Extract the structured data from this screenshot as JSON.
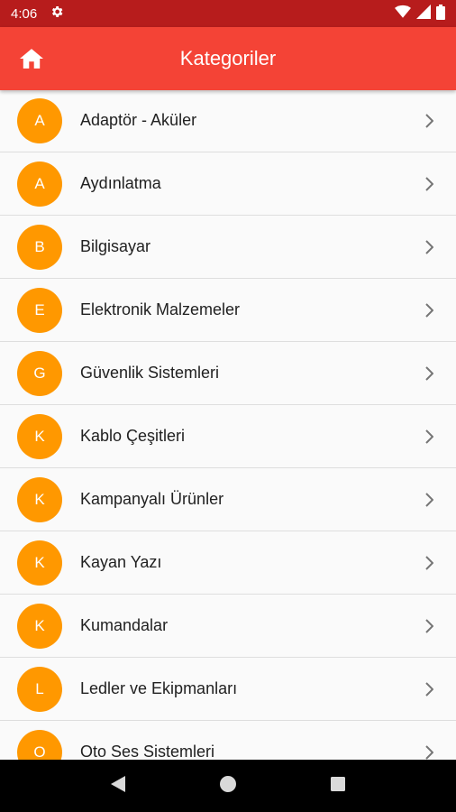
{
  "status_bar": {
    "time": "4:06"
  },
  "app_bar": {
    "title": "Kategoriler"
  },
  "colors": {
    "status_bar": "#b71c1c",
    "app_bar": "#f44336",
    "avatar": "#ff9800"
  },
  "categories": [
    {
      "letter": "A",
      "label": "Adaptör - Aküler"
    },
    {
      "letter": "A",
      "label": "Aydınlatma"
    },
    {
      "letter": "B",
      "label": "Bilgisayar"
    },
    {
      "letter": "E",
      "label": "Elektronik Malzemeler"
    },
    {
      "letter": "G",
      "label": "Güvenlik Sistemleri"
    },
    {
      "letter": "K",
      "label": "Kablo Çeşitleri"
    },
    {
      "letter": "K",
      "label": "Kampanyalı Ürünler"
    },
    {
      "letter": "K",
      "label": "Kayan Yazı"
    },
    {
      "letter": "K",
      "label": "Kumandalar"
    },
    {
      "letter": "L",
      "label": "Ledler ve Ekipmanları"
    },
    {
      "letter": "O",
      "label": "Oto Ses Sistemleri"
    }
  ]
}
